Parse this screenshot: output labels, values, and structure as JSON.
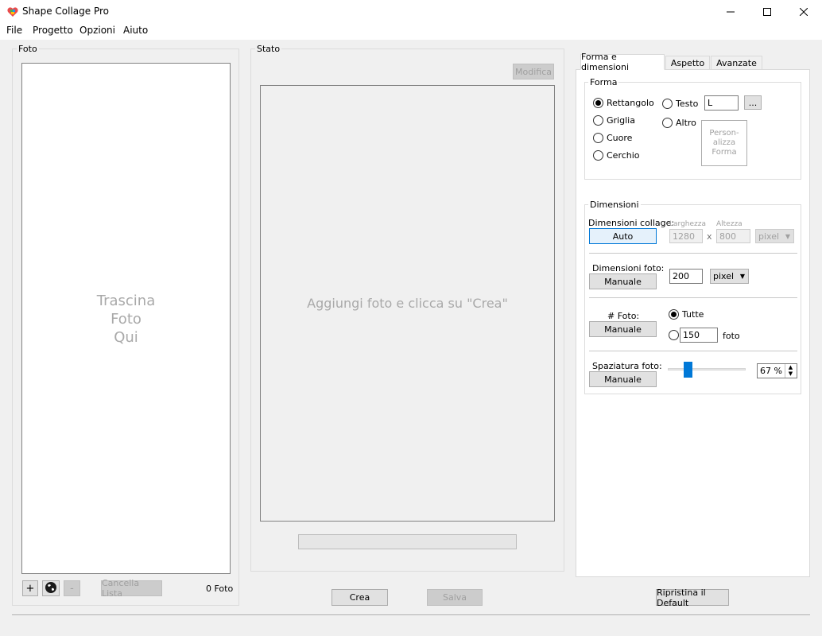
{
  "window": {
    "title": "Shape Collage Pro"
  },
  "menu": [
    "File",
    "Progetto",
    "Opzioni",
    "Aiuto"
  ],
  "photos": {
    "group_label": "Foto",
    "drop_hint": [
      "Trascina",
      "Foto",
      "Qui"
    ],
    "add_label": "+",
    "remove_label": "-",
    "clear_label": "Cancella Lista",
    "count_label": "0 Foto"
  },
  "status": {
    "group_label": "Stato",
    "edit_label": "Modifica",
    "preview_hint": "Aggiungi foto e clicca su \"Crea\""
  },
  "actions": {
    "create_label": "Crea",
    "save_label": "Salva",
    "reset_label": "Ripristina il Default"
  },
  "tabs": [
    {
      "label": "Forma e dimensioni",
      "active": true
    },
    {
      "label": "Aspetto",
      "active": false
    },
    {
      "label": "Avanzate",
      "active": false
    }
  ],
  "shape": {
    "group_label": "Forma",
    "options": [
      {
        "label": "Rettangolo",
        "selected": true
      },
      {
        "label": "Griglia",
        "selected": false
      },
      {
        "label": "Cuore",
        "selected": false
      },
      {
        "label": "Cerchio",
        "selected": false
      },
      {
        "label": "Testo",
        "selected": false
      },
      {
        "label": "Altro",
        "selected": false
      }
    ],
    "text_value": "L",
    "more_label": "...",
    "custom_label": [
      "Person-",
      "alizza",
      "Forma"
    ]
  },
  "dimensions": {
    "group_label": "Dimensioni",
    "collage_label": "Dimensioni collage:",
    "collage_mode": "Auto",
    "width_label": "Larghezza",
    "height_label": "Altezza",
    "width_value": "1280",
    "height_value": "800",
    "times": "x",
    "collage_unit": "pixel",
    "photo_size_label": "Dimensioni foto:",
    "photo_size_mode": "Manuale",
    "photo_size_value": "200",
    "photo_size_unit": "pixel",
    "count_label": "# Foto:",
    "count_mode": "Manuale",
    "count_all_label": "Tutte",
    "count_value": "150",
    "count_unit": "foto",
    "spacing_label": "Spaziatura foto:",
    "spacing_mode": "Manuale",
    "spacing_value": "67 %",
    "spacing_fraction": 0.26
  },
  "colors": {
    "accent": "#0078d7",
    "disabled_text": "#a0a0a0"
  },
  "icons": {
    "app": "shape-collage-icon",
    "globe": "globe-icon"
  }
}
